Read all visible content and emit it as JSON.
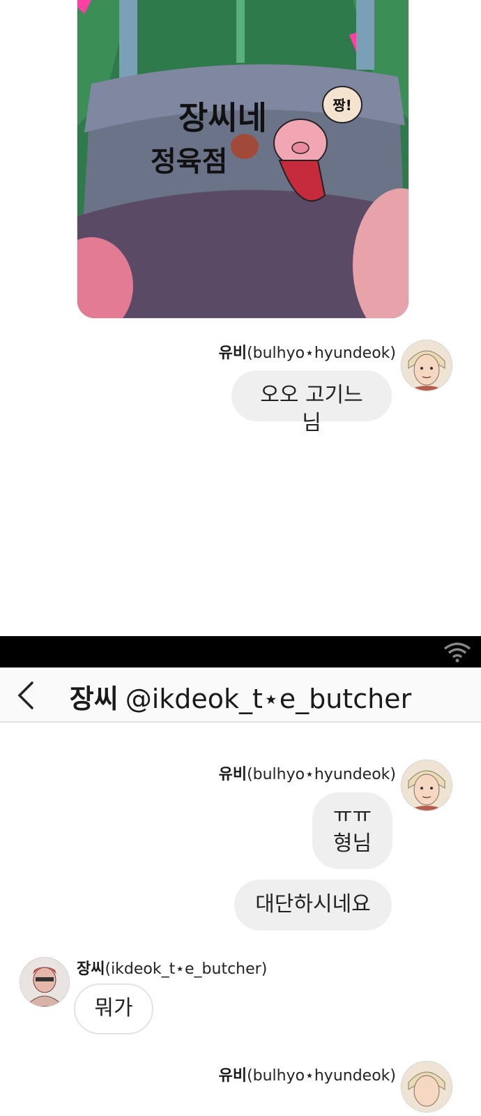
{
  "illustration": {
    "apron_text_line1": "장씨네",
    "apron_text_line2": "정육점",
    "speech": "짱!"
  },
  "messages_top": [
    {
      "sender_name": "유비",
      "sender_handle": "(bulhyo⋆hyundeok)",
      "bubbles": [
        "오오 고기느님"
      ]
    }
  ],
  "status_bar": {
    "icon": "wifi-icon"
  },
  "chat_header": {
    "back_icon": "chevron-left-icon",
    "name": "장씨",
    "handle": "@ikdeok_t⋆e_butcher"
  },
  "messages": [
    {
      "sender_name": "유비",
      "sender_handle": "(bulhyo⋆hyundeok)",
      "bubbles": [
        "ㅠㅠ",
        "형님",
        "대단하시네요"
      ]
    },
    {
      "sender_name": "장씨",
      "sender_handle": "(ikdeok_t⋆e_butcher)",
      "bubbles": [
        "뭐가"
      ]
    },
    {
      "sender_name": "유비",
      "sender_handle": "(bulhyo⋆hyundeok)",
      "bubbles": []
    }
  ],
  "colors": {
    "status_bar": "#000000",
    "bubble_gray": "#efefef",
    "app_bar": "#fafafa"
  }
}
